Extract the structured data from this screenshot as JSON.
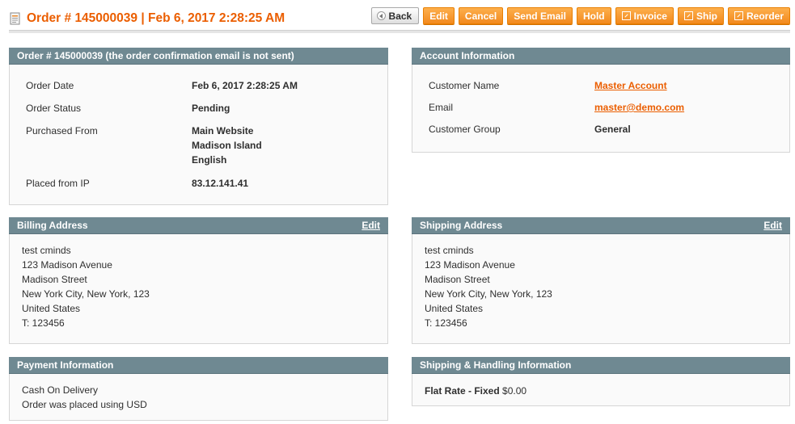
{
  "header": {
    "title": "Order # 145000039 | Feb 6, 2017 2:28:25 AM",
    "buttons": {
      "back": "Back",
      "edit": "Edit",
      "cancel": "Cancel",
      "send_email": "Send Email",
      "hold": "Hold",
      "invoice": "Invoice",
      "ship": "Ship",
      "reorder": "Reorder"
    }
  },
  "order_box": {
    "title": "Order # 145000039 (the order confirmation email is not sent)",
    "rows": [
      {
        "label": "Order Date",
        "value": [
          "Feb 6, 2017 2:28:25 AM"
        ]
      },
      {
        "label": "Order Status",
        "value": [
          "Pending"
        ]
      },
      {
        "label": "Purchased From",
        "value": [
          "Main Website",
          "Madison Island",
          "English"
        ]
      },
      {
        "label": "Placed from IP",
        "value": [
          "83.12.141.41"
        ]
      }
    ]
  },
  "account_box": {
    "title": "Account Information",
    "customer_name_label": "Customer Name",
    "customer_name": "Master Account",
    "email_label": "Email",
    "email": "master@demo.com",
    "group_label": "Customer Group",
    "group": "General"
  },
  "billing_box": {
    "title": "Billing Address",
    "edit": "Edit",
    "lines": [
      "test cminds",
      "123 Madison Avenue",
      "Madison Street",
      "New York City, New York, 123",
      "United States",
      "T: 123456"
    ]
  },
  "shipping_box": {
    "title": "Shipping Address",
    "edit": "Edit",
    "lines": [
      "test cminds",
      "123 Madison Avenue",
      "Madison Street",
      "New York City, New York, 123",
      "United States",
      "T: 123456"
    ]
  },
  "payment_box": {
    "title": "Payment Information",
    "lines": [
      "Cash On Delivery",
      "Order was placed using USD"
    ]
  },
  "shipping_method_box": {
    "title": "Shipping & Handling Information",
    "method": "Flat Rate - Fixed",
    "price": "$0.00"
  },
  "colors": {
    "accent": "#eb5e00",
    "button": "#f2891e",
    "box_header": "#6f8992"
  }
}
